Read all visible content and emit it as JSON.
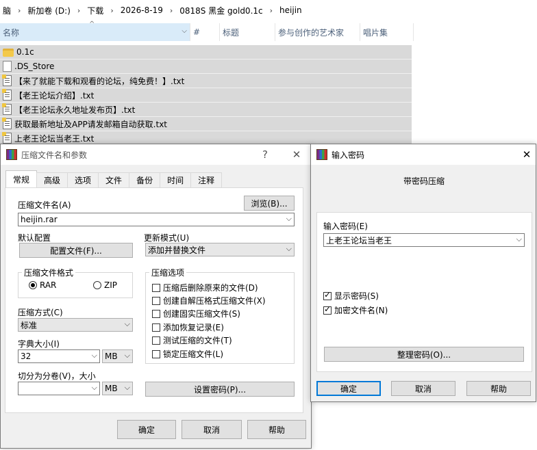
{
  "explorer": {
    "breadcrumb": [
      "脑",
      "新加卷 (D:)",
      "下载",
      "2026-8-19",
      "0818S 黑金 gold0.1c",
      "heijin"
    ],
    "breadcrumb_separator": "›",
    "columns": [
      "名称",
      "#",
      "标题",
      "参与创作的艺术家",
      "唱片集"
    ],
    "files": [
      {
        "name": "0.1c",
        "icon": "folder-icon"
      },
      {
        "name": ".DS_Store",
        "icon": "file-icon"
      },
      {
        "name": "【来了就能下载和观看的论坛，纯免费！】.txt",
        "icon": "text-file-icon"
      },
      {
        "name": "【老王论坛介绍】.txt",
        "icon": "text-file-icon"
      },
      {
        "name": "【老王论坛永久地址发布页】.txt",
        "icon": "text-file-icon"
      },
      {
        "name": "获取最新地址及APP请发邮箱自动获取.txt",
        "icon": "text-file-icon"
      },
      {
        "name": "上老王论坛当老王.txt",
        "icon": "text-file-icon"
      }
    ]
  },
  "archive_dialog": {
    "title": "压缩文件名和参数",
    "help_glyph": "?",
    "close_glyph": "✕",
    "tabs": [
      "常规",
      "高级",
      "选项",
      "文件",
      "备份",
      "时间",
      "注释"
    ],
    "active_tab": "常规",
    "archive_name_label": "压缩文件名(A)",
    "archive_name_value": "heijin.rar",
    "browse_button": "浏览(B)...",
    "default_profile_label": "默认配置",
    "profiles_button": "配置文件(F)...",
    "update_mode_label": "更新模式(U)",
    "update_mode_value": "添加并替换文件",
    "archive_format_label": "压缩文件格式",
    "format_rar": "RAR",
    "format_zip": "ZIP",
    "compression_method_label": "压缩方式(C)",
    "compression_method_value": "标准",
    "dictionary_size_label": "字典大小(I)",
    "dictionary_size_value": "32",
    "dictionary_unit": "MB",
    "split_label": "切分为分卷(V)，大小",
    "split_value": "",
    "split_unit": "MB",
    "archiving_options_label": "压缩选项",
    "options": [
      {
        "label": "压缩后删除原来的文件(D)",
        "checked": false
      },
      {
        "label": "创建自解压格式压缩文件(X)",
        "checked": false
      },
      {
        "label": "创建固实压缩文件(S)",
        "checked": false
      },
      {
        "label": "添加恢复记录(E)",
        "checked": false
      },
      {
        "label": "测试压缩的文件(T)",
        "checked": false
      },
      {
        "label": "锁定压缩文件(L)",
        "checked": false
      }
    ],
    "set_password_button": "设置密码(P)...",
    "ok_button": "确定",
    "cancel_button": "取消",
    "help_button": "帮助"
  },
  "password_dialog": {
    "title": "输入密码",
    "close_glyph": "✕",
    "heading": "带密码压缩",
    "enter_password_label": "输入密码(E)",
    "password_value": "上老王论坛当老王",
    "show_password_label": "显示密码(S)",
    "show_password_checked": true,
    "encrypt_names_label": "加密文件名(N)",
    "encrypt_names_checked": true,
    "organize_button": "整理密码(O)...",
    "ok_button": "确定",
    "cancel_button": "取消",
    "help_button": "帮助"
  },
  "colors": {
    "selection_gray": "#d9d9d9",
    "sorted_column": "#d9ebf9",
    "dialog_bg": "#f0f0f0",
    "accent": "#0078d7"
  }
}
